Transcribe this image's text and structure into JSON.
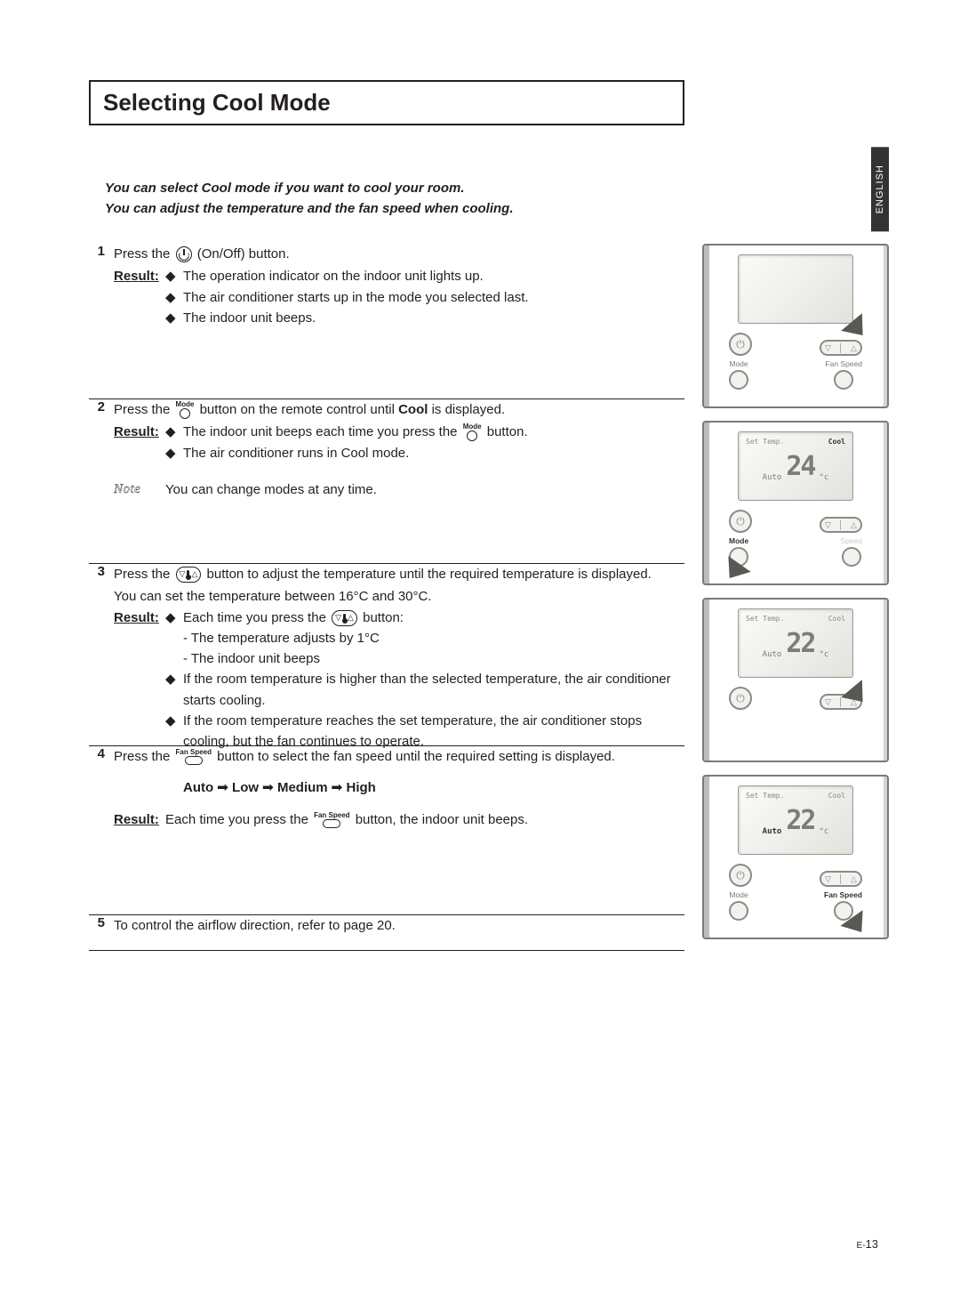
{
  "title": "Selecting Cool Mode",
  "language_tab": "ENGLISH",
  "intro_line1": "You can select Cool mode if you want to cool your room.",
  "intro_line2": "You can adjust the temperature and the fan speed when cooling.",
  "labels": {
    "result": "Result",
    "note": "Note",
    "mode": "Mode",
    "fan_speed": "Fan Speed",
    "set_temp": "Set Temp.",
    "cool": "Cool",
    "auto": "Auto"
  },
  "steps": [
    {
      "num": "1",
      "text_before": "Press the ",
      "text_after": " (On/Off) button.",
      "results": [
        "The operation indicator on the indoor unit lights up.",
        "The air conditioner starts up in the mode you selected last.",
        "The indoor unit beeps."
      ]
    },
    {
      "num": "2",
      "text_a": "Press the ",
      "text_b": " button on the remote control until ",
      "text_bold": "Cool",
      "text_c": " is displayed.",
      "results_a": "The indoor unit beeps each time you press the ",
      "results_a2": " button.",
      "results_b": "The air conditioner runs in Cool mode.",
      "note": "You can change modes at any time."
    },
    {
      "num": "3",
      "text_a": "Press the ",
      "text_b": " button to adjust the temperature until the required temperature is displayed.",
      "text_c": "You can set the temperature between 16°C and 30°C.",
      "r1a": "Each time you press the ",
      "r1b": " button:",
      "r1s1": "- The temperature adjusts by 1°C",
      "r1s2": "- The indoor unit beeps",
      "r2": "If the room temperature is higher than the selected temperature, the air conditioner starts cooling.",
      "r3": "If the room temperature reaches the set temperature, the air conditioner stops cooling, but the fan continues to operate."
    },
    {
      "num": "4",
      "text_a": "Press the ",
      "text_b": " button to select the fan speed until the required setting is displayed.",
      "sequence": "Auto ➟ Low ➟ Medium ➟ High",
      "result_a": "Each time you press the ",
      "result_b": " button, the indoor unit beeps."
    },
    {
      "num": "5",
      "text": "To control the airflow direction, refer to page 20."
    }
  ],
  "remote_displays": {
    "r2_temp": "24",
    "r3_temp": "22",
    "r4_temp": "22"
  },
  "page_number": {
    "prefix": "E-",
    "num": "13"
  }
}
